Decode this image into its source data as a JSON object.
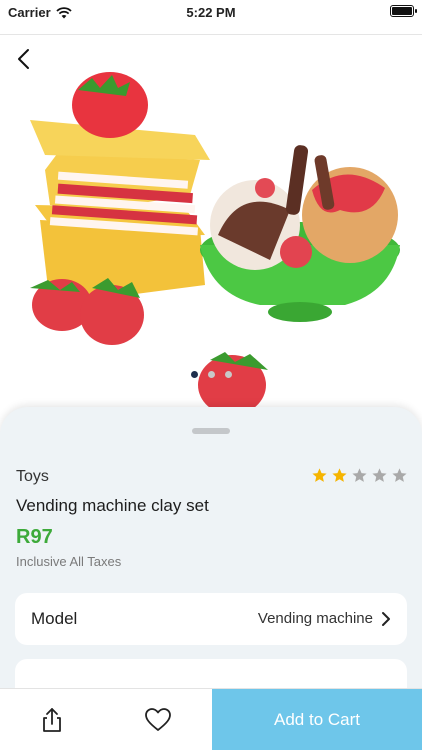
{
  "status_bar": {
    "carrier": "Carrier",
    "time": "5:22 PM"
  },
  "product": {
    "category": "Toys",
    "title": "Vending machine clay set",
    "price": "R97",
    "tax_note": "Inclusive All Taxes",
    "rating": 2,
    "rating_max": 5,
    "image_pages": 3,
    "active_page": 1
  },
  "options": [
    {
      "label": "Model",
      "value": "Vending machine"
    }
  ],
  "actions": {
    "add_to_cart": "Add to Cart"
  },
  "colors": {
    "price": "#3daa3a",
    "star_filled": "#f5b400",
    "star_empty": "#a9a9a9",
    "cart_button": "#6ec6ea",
    "sheet_background": "#eef3f6"
  },
  "icons": [
    "wifi-icon",
    "battery-icon",
    "back-chevron-icon",
    "star-icon",
    "chevron-right-icon",
    "share-icon",
    "heart-icon"
  ]
}
